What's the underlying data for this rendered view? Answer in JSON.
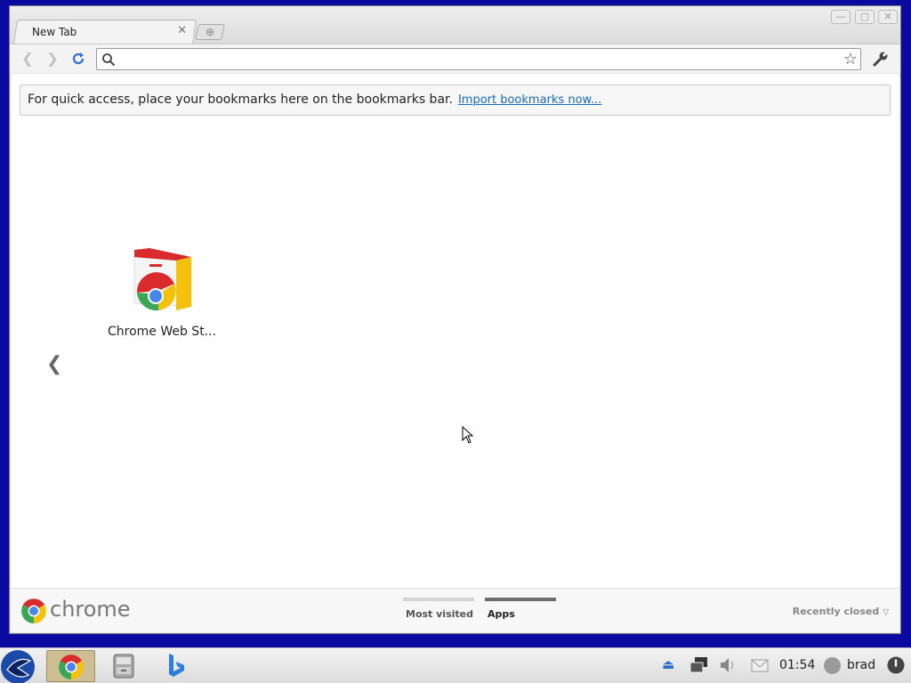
{
  "window": {
    "tabs": [
      {
        "label": "New Tab"
      }
    ]
  },
  "toolbar": {
    "omnibox_value": "",
    "omnibox_placeholder": ""
  },
  "bookmarks_bar": {
    "message": "For quick access, place your bookmarks here on the bookmarks bar.",
    "import_link": "Import bookmarks now..."
  },
  "apps": [
    {
      "label": "Chrome Web St...",
      "icon": "chrome-web-store-icon"
    }
  ],
  "footer": {
    "brand": "chrome",
    "tabs": [
      {
        "label": "Most visited",
        "selected": false
      },
      {
        "label": "Apps",
        "selected": true
      }
    ],
    "recently_closed": "Recently closed"
  },
  "taskbar": {
    "clock": "01:54",
    "user": "brad",
    "apps": [
      "start-menu-icon",
      "chrome-icon",
      "file-manager-icon",
      "bing-icon"
    ],
    "tray": [
      "eject-icon",
      "network-icon",
      "volume-icon",
      "mail-icon"
    ]
  },
  "colors": {
    "desktop": "#0a0aa0",
    "link": "#1a6bbf",
    "selected_tab_bar": "#6e6e6e",
    "unselected_tab_bar": "#d4d4d4"
  }
}
